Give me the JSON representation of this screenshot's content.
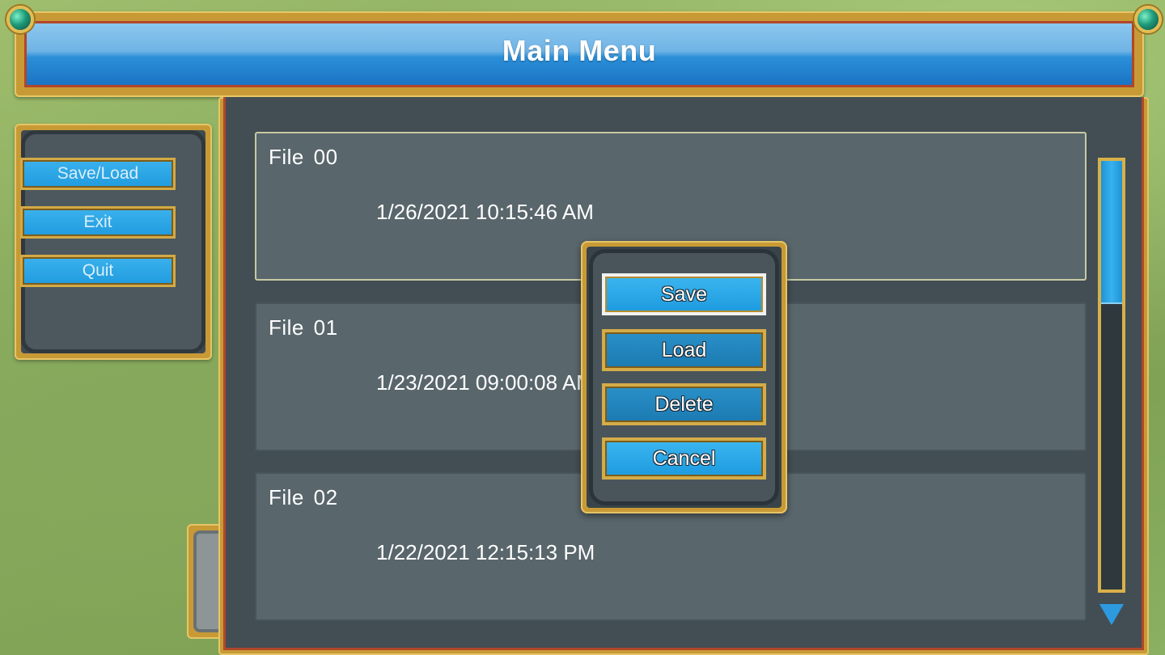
{
  "title": "Main Menu",
  "side_menu": {
    "items": [
      {
        "label": "Save/Load"
      },
      {
        "label": "Exit"
      },
      {
        "label": "Quit"
      }
    ]
  },
  "files": [
    {
      "name": "File  00",
      "date": "1/26/2021 10:15:46 AM",
      "selected": true
    },
    {
      "name": "File  01",
      "date": "1/23/2021 09:00:08 AM",
      "selected": false
    },
    {
      "name": "File  02",
      "date": "1/22/2021 12:15:13 PM",
      "selected": false
    }
  ],
  "popup": {
    "buttons": [
      {
        "label": "Save",
        "active": true
      },
      {
        "label": "Load",
        "active": false
      },
      {
        "label": "Delete",
        "active": false
      },
      {
        "label": "Cancel",
        "active": false
      }
    ]
  },
  "scrollbar": {
    "position": 0.0,
    "visible_fraction": 0.33
  },
  "icons": {
    "scroll_down": "triangle-down-icon",
    "corner_gem": "gem-icon"
  },
  "colors": {
    "accent_blue": "#2b8fd8",
    "gold_frame": "#d8b04a",
    "panel": "#434e54"
  }
}
